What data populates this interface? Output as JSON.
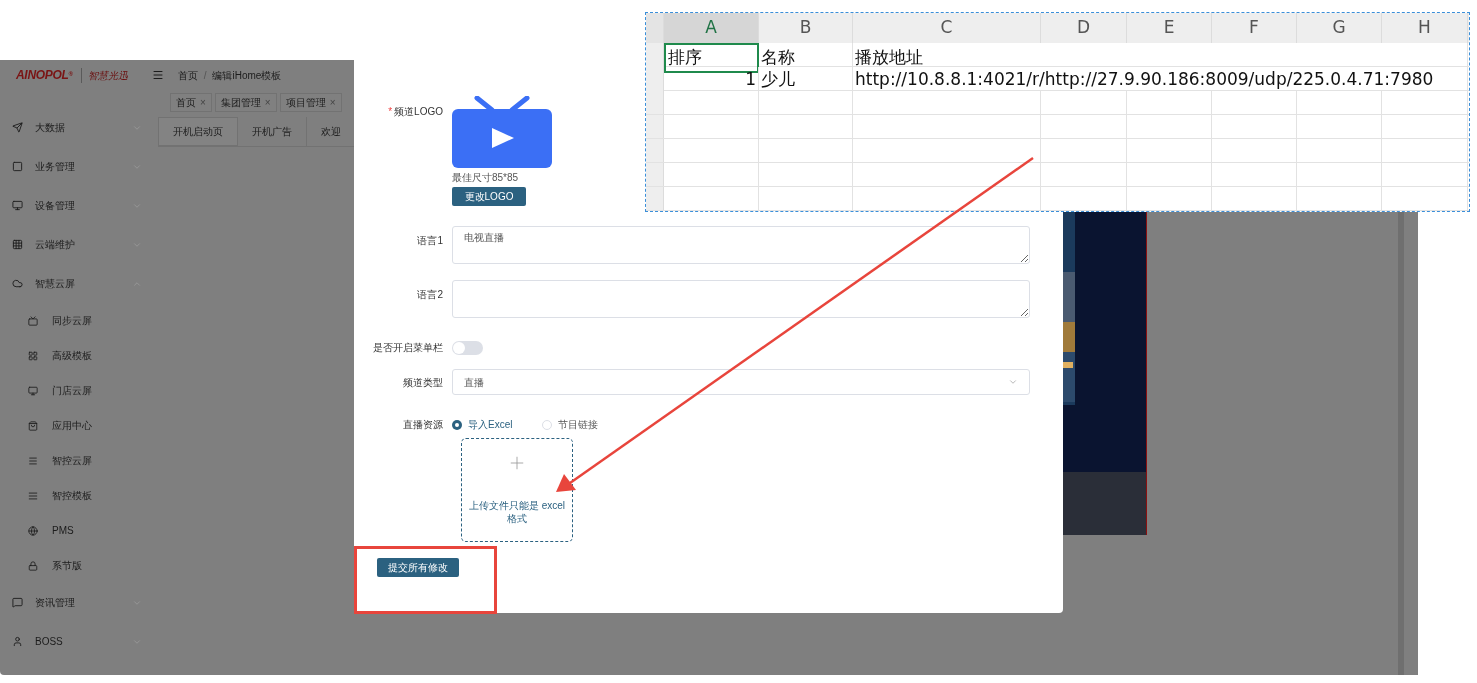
{
  "app": {
    "logo": "AINOPOL",
    "logo_mark": "®",
    "logo_cn": "智慧光迅",
    "breadcrumb": {
      "items": [
        "首页",
        "编辑iHome模板"
      ],
      "separator": "/"
    },
    "open_tags": [
      {
        "label": "首页",
        "close": "×"
      },
      {
        "label": "集团管理",
        "close": "×"
      },
      {
        "label": "项目管理",
        "close": "×"
      }
    ],
    "tabs": [
      {
        "label": "开机启动页",
        "selected": true
      },
      {
        "label": "开机广告",
        "selected": false
      },
      {
        "label": "欢迎",
        "selected": false
      }
    ],
    "sidebar": {
      "items": [
        {
          "label": "大数据",
          "expanded": false
        },
        {
          "label": "业务管理",
          "expanded": false
        },
        {
          "label": "设备管理",
          "expanded": false
        },
        {
          "label": "云端维护",
          "expanded": false
        },
        {
          "label": "智慧云屏",
          "expanded": true,
          "children": [
            {
              "label": "同步云屏"
            },
            {
              "label": "高级模板"
            },
            {
              "label": "门店云屏"
            },
            {
              "label": "应用中心"
            },
            {
              "label": "智控云屏"
            },
            {
              "label": "智控模板"
            },
            {
              "label": "PMS"
            },
            {
              "label": "系节版"
            }
          ]
        },
        {
          "label": "资讯管理",
          "expanded": false
        },
        {
          "label": "BOSS",
          "expanded": false
        }
      ]
    }
  },
  "dialog": {
    "logo_field": {
      "label": "频道LOGO",
      "required_mark": "*",
      "hint": "最佳尺寸85*85",
      "button": "更改LOGO"
    },
    "text_fields": [
      {
        "label": "语言1",
        "value": "电视直播"
      },
      {
        "label": "语言2"
      }
    ],
    "menu_toggle": {
      "label": "是否开启菜单栏",
      "on": false
    },
    "type_select": {
      "label": "频道类型",
      "value": "直播"
    },
    "source": {
      "label": "直播资源",
      "options": [
        {
          "label": "导入Excel",
          "selected": true
        },
        {
          "label": "节目链接",
          "selected": false
        }
      ]
    },
    "upload": {
      "hint": "上传文件只能是 excel 格式"
    },
    "submit": "提交所有修改"
  },
  "spreadsheet": {
    "columns": [
      {
        "label": "A",
        "selected": true
      },
      {
        "label": "B",
        "selected": false
      },
      {
        "label": "C",
        "selected": false
      },
      {
        "label": "D",
        "selected": false
      },
      {
        "label": "E",
        "selected": false
      },
      {
        "label": "F",
        "selected": false
      },
      {
        "label": "G",
        "selected": false
      },
      {
        "label": "H",
        "selected": false
      }
    ],
    "rows": [
      {
        "cells": [
          {
            "text": "排序",
            "kind": "text",
            "selected": true
          },
          {
            "text": "名称",
            "kind": "text",
            "selected": false
          },
          {
            "text": "播放地址",
            "kind": "text",
            "selected": false
          }
        ]
      },
      {
        "cells": [
          {
            "text": "1",
            "kind": "number",
            "selected": false
          },
          {
            "text": "少儿",
            "kind": "text",
            "selected": false
          },
          {
            "text": "http://10.8.8.1:4021/r/http://27.9.90.186:8009/udp/225.0.4.71:7980",
            "kind": "text",
            "selected": false
          }
        ]
      }
    ]
  }
}
